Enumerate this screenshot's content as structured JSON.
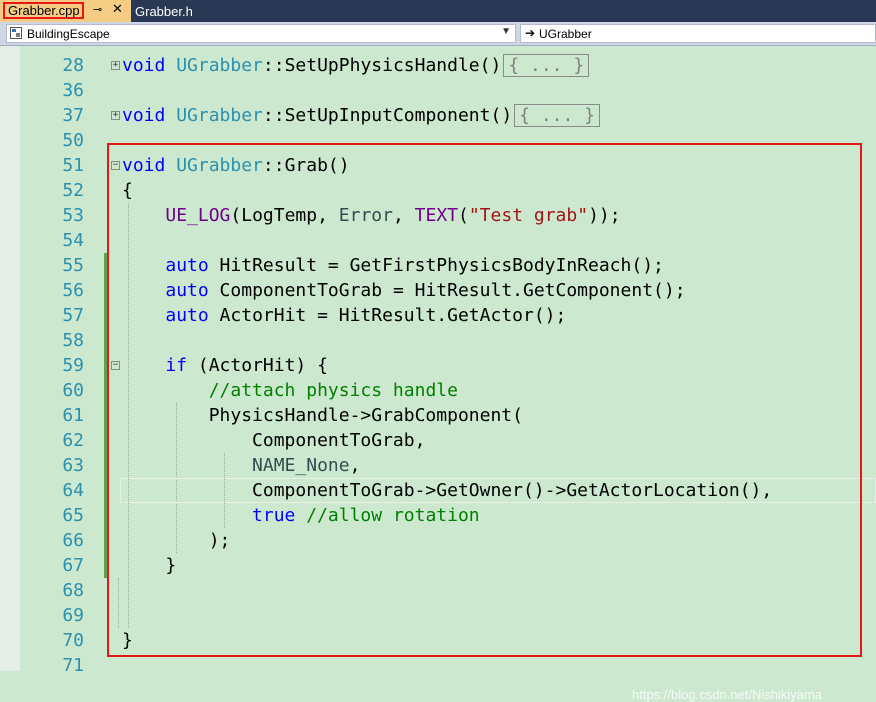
{
  "tabs": [
    {
      "label": "Grabber.cpp",
      "active": true
    },
    {
      "label": "Grabber.h",
      "active": false
    }
  ],
  "navbar": {
    "project": "BuildingEscape",
    "scope": "UGrabber"
  },
  "line_numbers": [
    "28",
    "36",
    "37",
    "50",
    "51",
    "52",
    "53",
    "54",
    "55",
    "56",
    "57",
    "58",
    "59",
    "60",
    "61",
    "62",
    "63",
    "64",
    "65",
    "66",
    "67",
    "68",
    "69",
    "70",
    "71"
  ],
  "code": {
    "l28": {
      "kw": "void",
      "cls": "UGrabber",
      "rest": "::SetUpPhysicsHandle()",
      "collapsed": "{ ... }"
    },
    "l37": {
      "kw": "void",
      "cls": "UGrabber",
      "rest": "::SetUpInputComponent()",
      "collapsed": "{ ... }"
    },
    "l51": {
      "kw": "void",
      "cls": "UGrabber",
      "rest": "::Grab()"
    },
    "l52": "{",
    "l53": {
      "indent": "    ",
      "macro": "UE_LOG",
      "p1": "(LogTemp, ",
      "err": "Error",
      "p2": ", ",
      "tmac": "TEXT",
      "p3": "(",
      "str": "\"Test grab\"",
      "p4": "));"
    },
    "l55": {
      "indent": "    ",
      "kw": "auto",
      "rest": " HitResult = GetFirstPhysicsBodyInReach();"
    },
    "l56": {
      "indent": "    ",
      "kw": "auto",
      "rest": " ComponentToGrab = HitResult.GetComponent();"
    },
    "l57": {
      "indent": "    ",
      "kw": "auto",
      "rest": " ActorHit = HitResult.GetActor();"
    },
    "l59": {
      "indent": "    ",
      "kw": "if",
      "rest": " (ActorHit) {"
    },
    "l60": {
      "indent": "        ",
      "comment": "//attach physics handle"
    },
    "l61": "        PhysicsHandle->GrabComponent(",
    "l62": "            ComponentToGrab,",
    "l63": {
      "indent": "            ",
      "enum": "NAME_None",
      "rest": ","
    },
    "l64": "            ComponentToGrab->GetOwner()->GetActorLocation(),",
    "l65": {
      "indent": "            ",
      "kw": "true",
      "sp": " ",
      "comment": "//allow rotation"
    },
    "l66": "        );",
    "l67": "    }",
    "l70": "}"
  },
  "watermark": "https://blog.csdn.net/Nishikiyama",
  "colors": {
    "background": "#cce8cf",
    "keyword": "#0000ff",
    "type": "#2b91af",
    "macro": "#6f008a",
    "string": "#a31515",
    "comment": "#008000",
    "highlight_border": "#e81818",
    "tab_active": "#f5cc84",
    "tabbar": "#293955"
  }
}
